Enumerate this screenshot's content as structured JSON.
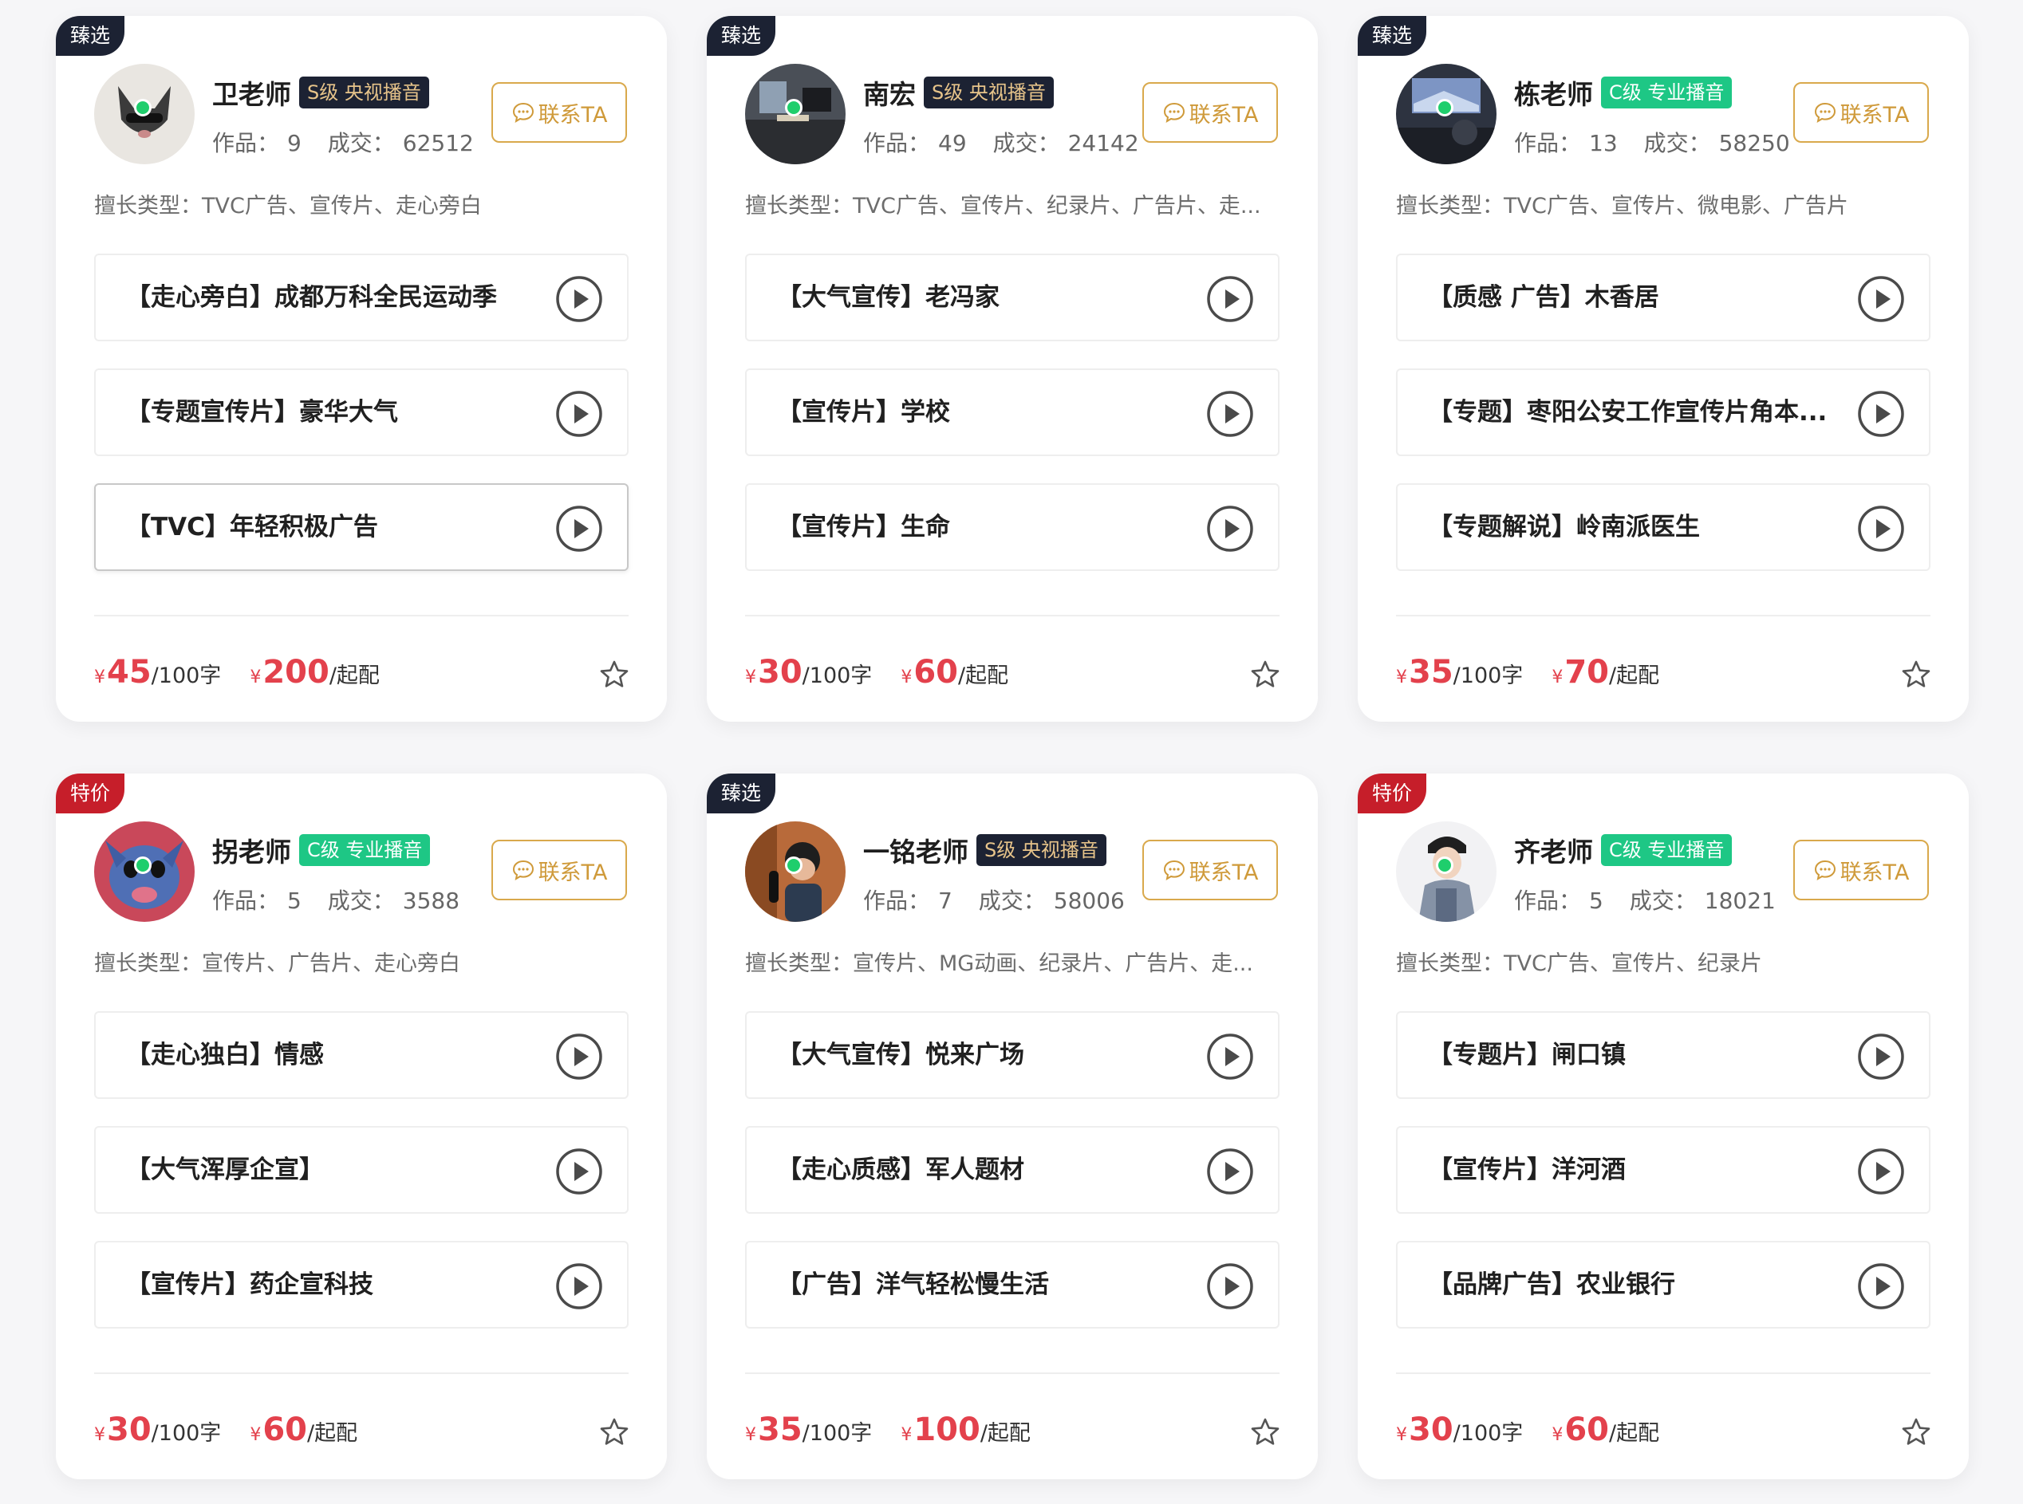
{
  "colors": {
    "price": "#e3414c",
    "contact_border": "#d9a94c",
    "level_s_bg": "#1c2233",
    "level_s_text": "#e7c48a",
    "level_c_bg": "#1ec785",
    "tag_dark": "#1c2233",
    "tag_red": "#c61e2a",
    "online": "#1fce6c"
  },
  "labels": {
    "contact": "联系TA",
    "works_label": "作品：",
    "deals_label": "成交：",
    "skills_label": "擅长类型：",
    "per_100": "/100字",
    "min_order": "/起配",
    "yen": "¥"
  },
  "icons": {
    "contact": "chat-bubble-icon",
    "play": "play-circle-icon",
    "favorite": "star-outline-icon",
    "online": "online-status-dot"
  },
  "cards": [
    {
      "tag": "臻选",
      "tag_style": "dark",
      "name": "卫老师",
      "level": "S级 央视播音",
      "level_style": "s",
      "works": "9",
      "deals": "62512",
      "skills": "TVC广告、宣传片、走心旁白",
      "samples": [
        "【走心旁白】成都万科全民运动季",
        "【专题宣传片】豪华大气",
        "【TVC】年轻积极广告"
      ],
      "price_per_100": "45",
      "price_min": "200"
    },
    {
      "tag": "臻选",
      "tag_style": "dark",
      "name": "南宏",
      "level": "S级 央视播音",
      "level_style": "s",
      "works": "49",
      "deals": "24142",
      "skills": "TVC广告、宣传片、纪录片、广告片、走...",
      "samples": [
        "【大气宣传】老冯家",
        "【宣传片】学校",
        "【宣传片】生命"
      ],
      "price_per_100": "30",
      "price_min": "60"
    },
    {
      "tag": "臻选",
      "tag_style": "dark",
      "name": "栋老师",
      "level": "C级 专业播音",
      "level_style": "c",
      "works": "13",
      "deals": "58250",
      "skills": "TVC广告、宣传片、微电影、广告片",
      "samples": [
        "【质感 广告】木香居",
        "【专题】枣阳公安工作宣传片角本...",
        "【专题解说】岭南派医生"
      ],
      "price_per_100": "35",
      "price_min": "70"
    },
    {
      "tag": "特价",
      "tag_style": "red",
      "name": "拐老师",
      "level": "C级 专业播音",
      "level_style": "c",
      "works": "5",
      "deals": "3588",
      "skills": "宣传片、广告片、走心旁白",
      "samples": [
        "【走心独白】情感",
        "【大气浑厚企宣】",
        "【宣传片】药企宣科技"
      ],
      "price_per_100": "30",
      "price_min": "60"
    },
    {
      "tag": "臻选",
      "tag_style": "dark",
      "name": "一铭老师",
      "level": "S级 央视播音",
      "level_style": "s",
      "works": "7",
      "deals": "58006",
      "skills": "宣传片、MG动画、纪录片、广告片、走...",
      "samples": [
        "【大气宣传】悦来广场",
        "【走心质感】军人题材",
        "【广告】洋气轻松慢生活"
      ],
      "price_per_100": "35",
      "price_min": "100"
    },
    {
      "tag": "特价",
      "tag_style": "red",
      "name": "齐老师",
      "level": "C级 专业播音",
      "level_style": "c",
      "works": "5",
      "deals": "18021",
      "skills": "TVC广告、宣传片、纪录片",
      "samples": [
        "【专题片】闸口镇",
        "【宣传片】洋河酒",
        "【品牌广告】农业银行"
      ],
      "price_per_100": "30",
      "price_min": "60"
    }
  ]
}
